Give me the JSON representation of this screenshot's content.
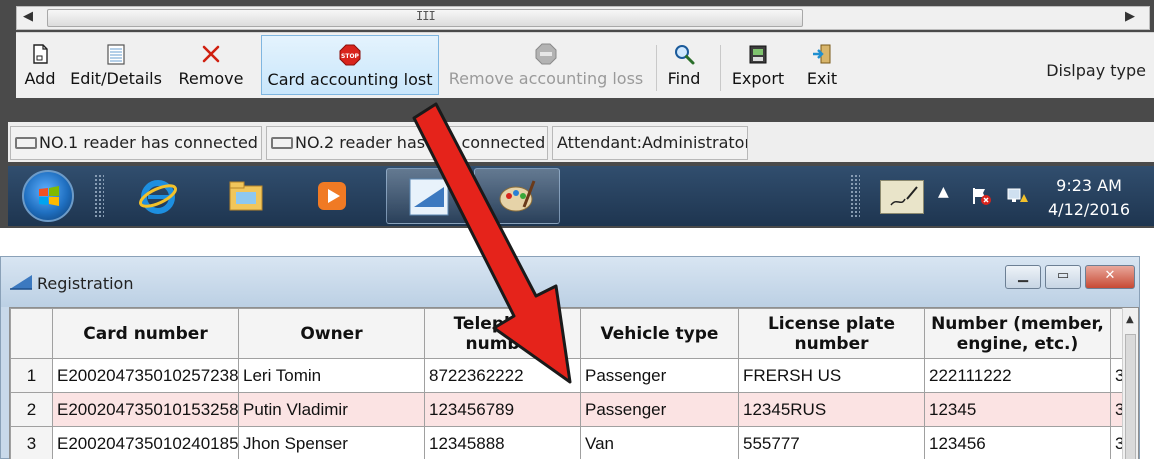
{
  "toolbar": {
    "add_label": "Add",
    "edit_label": "Edit/Details",
    "remove_label": "Remove",
    "card_lost_label": "Card accounting lost",
    "remove_loss_label": "Remove accounting loss",
    "find_label": "Find",
    "export_label": "Export",
    "exit_label": "Exit",
    "display_type_label": "Dislpay type"
  },
  "hscroll": {
    "grip": "III"
  },
  "statusbar": {
    "reader1": "NO.1 reader has connected",
    "reader2": "NO.2 reader has not connected",
    "attendant": "Attendant:Administrator"
  },
  "taskbar": {
    "time": "9:23 AM",
    "date": "4/12/2016"
  },
  "registration": {
    "title": "Registration",
    "columns": [
      "Card number",
      "Owner",
      "Telephone number",
      "Vehicle type",
      "License plate number",
      "Number (member, engine, etc.)"
    ],
    "rows": [
      {
        "num": "1",
        "card": "E200204735010257238",
        "owner": "Leri Tomin",
        "phone": "8722362222",
        "vehicle": "Passenger",
        "plate": "FRERSH US",
        "member": "222111222",
        "extra": "3"
      },
      {
        "num": "2",
        "card": "E200204735010153258",
        "owner": "Putin Vladimir",
        "phone": "123456789",
        "vehicle": "Passenger",
        "plate": "12345RUS",
        "member": "12345",
        "extra": "3"
      },
      {
        "num": "3",
        "card": "E200204735010240185",
        "owner": "Jhon Spenser",
        "phone": "12345888",
        "vehicle": "Van",
        "plate": "555777",
        "member": "123456",
        "extra": "3"
      }
    ],
    "selected_row": 2
  },
  "colors": {
    "selected_row": "#fbe3e3",
    "arrow": "#e5231b",
    "taskbar": "#27415f"
  },
  "icons": {
    "add": "new-document-icon",
    "edit": "form-icon",
    "remove": "red-x-icon",
    "card_lost": "stop-sign-icon",
    "remove_loss": "gray-stop-icon",
    "find": "magnifier-icon",
    "export": "export-icon",
    "exit": "exit-door-icon"
  }
}
